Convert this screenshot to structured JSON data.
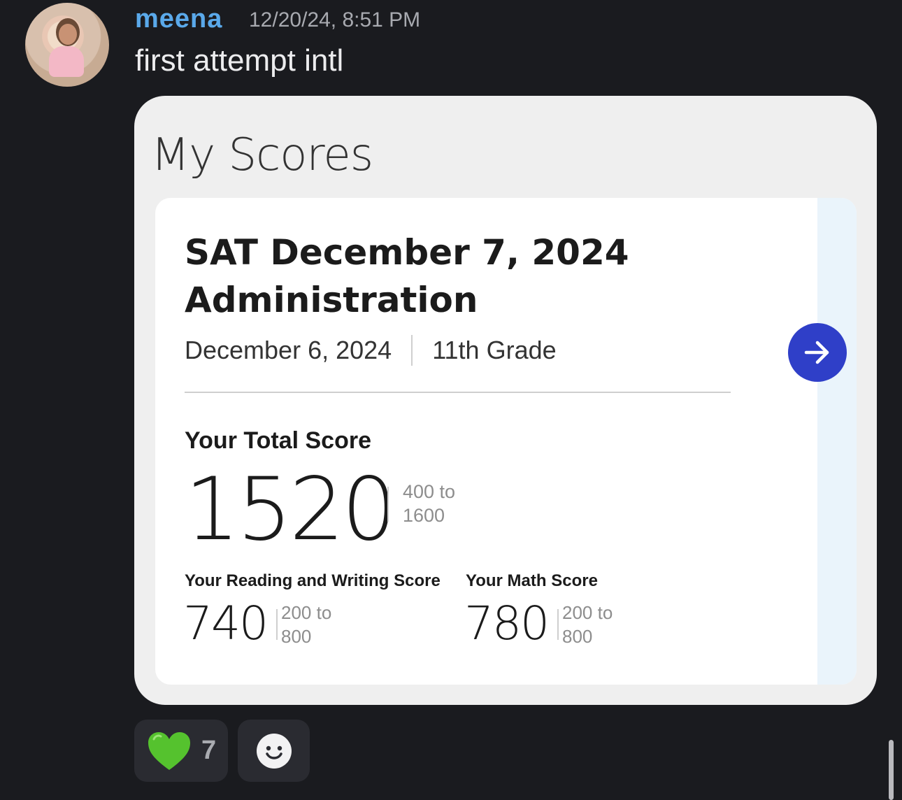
{
  "message": {
    "author": "meena",
    "timestamp": "12/20/24, 8:51 PM",
    "text": "first attempt intl",
    "avatar_icon": "user-avatar"
  },
  "embed": {
    "title": "My Scores",
    "card": {
      "test_title_line1": "SAT December 7, 2024",
      "test_title_line2": "Administration",
      "date": "December 6, 2024",
      "grade": "11th Grade",
      "total_label": "Your Total Score",
      "total_score": "1520",
      "total_range_line1": "400 to",
      "total_range_line2": "1600",
      "rw_label": "Your Reading and Writing Score",
      "rw_score": "740",
      "rw_range_line1": "200 to",
      "rw_range_line2": "800",
      "math_label": "Your Math Score",
      "math_score": "780",
      "math_range_line1": "200 to",
      "math_range_line2": "800",
      "next_icon": "arrow-right-icon"
    }
  },
  "reactions": [
    {
      "emoji": "💚",
      "count": "7"
    },
    {
      "icon": "add-reaction-icon"
    }
  ],
  "colors": {
    "background": "#1a1b1f",
    "username": "#5aa9ea",
    "accent_button": "#2f3fc8"
  }
}
